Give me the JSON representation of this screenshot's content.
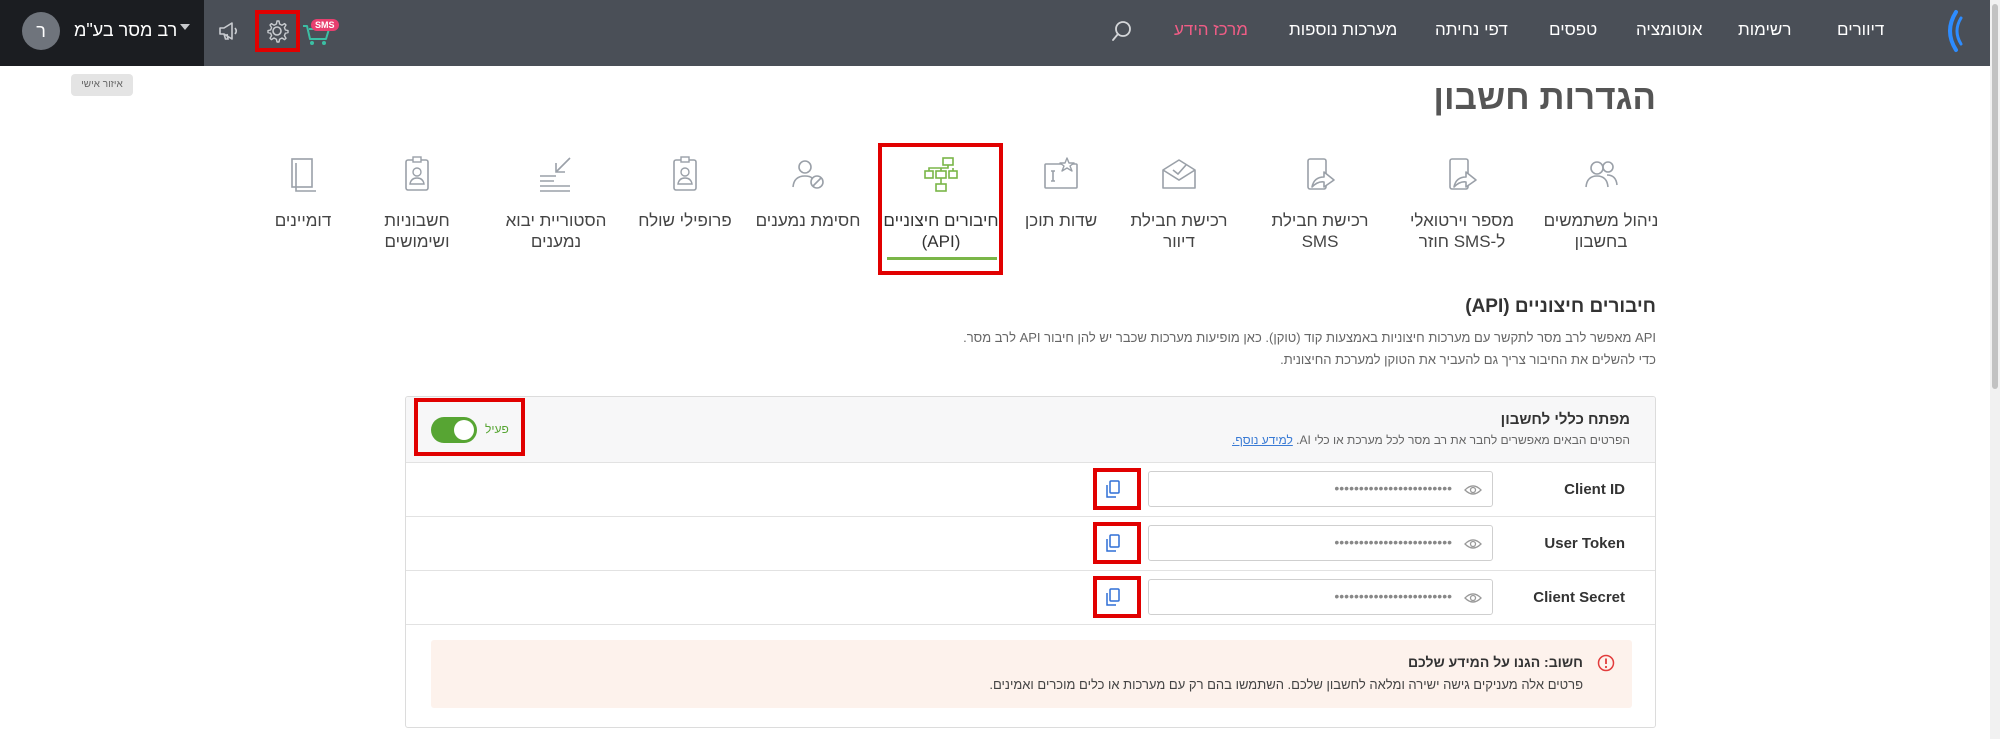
{
  "account": {
    "avatar_letter": "ר",
    "name": "רב מסר בע\"מ"
  },
  "topbar": {
    "sms_badge": "SMS",
    "nav": [
      "דיוורים",
      "רשימות",
      "אוטומציה",
      "טפסים",
      "דפי נחיתה",
      "מערכות נוספות",
      "מרכז הידע"
    ],
    "active_nav": "מרכז הידע",
    "icons": [
      "megaphone-icon",
      "gear-icon",
      "cart-icon",
      "search-icon",
      "logo-icon"
    ]
  },
  "tooltip": "איזור אישי",
  "page_title": "הגדרות חשבון",
  "tiles": [
    {
      "label_1": "ניהול משתמשים",
      "label_2": "בחשבון"
    },
    {
      "label_1": "מספר וירטואלי",
      "label_2": "ל-SMS חוזר"
    },
    {
      "label_1": "רכישת חבילת",
      "label_2": "SMS"
    },
    {
      "label_1": "רכישת חבילת",
      "label_2": "דיוור"
    },
    {
      "label_1": "שדות תוכן",
      "label_2": ""
    },
    {
      "label_1": "חיבורים חיצוניים",
      "label_2": "(API)"
    },
    {
      "label_1": "חסימת נמענים",
      "label_2": ""
    },
    {
      "label_1": "פרופילי שולח",
      "label_2": ""
    },
    {
      "label_1": "הסטוריית יבוא",
      "label_2": "נמענים"
    },
    {
      "label_1": "חשבוניות",
      "label_2": "ושימושים"
    },
    {
      "label_1": "דומיינים",
      "label_2": ""
    }
  ],
  "active_tile": "חיבורים חיצוניים (API)",
  "section": {
    "title": "חיבורים חיצוניים (API)",
    "desc_1": "API מאפשר לרב מסר לתקשר עם מערכות חיצוניות באמצעות קוד (טוקן). כאן מופיעות מערכות שכבר יש להן חיבור API לרב מסר.",
    "desc_2": "כדי להשלים את החיבור צריך גם להעביר את הטוקן למערכת החיצונית."
  },
  "card": {
    "title": "מפתח כללי לחשבון",
    "subtitle": "הפרטים הבאים מאפשרים לחבר את רב מסר לכל מערכת או כלי AI.",
    "more_link": "למידע נוסף.",
    "toggle_label": "פעיל",
    "toggle_on": true,
    "rows": [
      {
        "label": "Client ID",
        "value": "••••••••••••••••••••••••"
      },
      {
        "label": "User Token",
        "value": "••••••••••••••••••••••••"
      },
      {
        "label": "Client Secret",
        "value": "••••••••••••••••••••••••"
      }
    ],
    "warning_title": "חשוב: הגנו על המידע שלכם",
    "warning_text": "פרטים אלה מעניקים גישה ישירה ומלאה לחשבון שלכם. השתמשו בהם רק עם מערכות או כלים מוכרים ואמינים."
  },
  "colors": {
    "topbar": "#4a4f57",
    "account_box": "#1b1d21",
    "accent_pink": "#f05d86",
    "accent_green": "#57a533",
    "highlight_red": "#e10000",
    "link_blue": "#3a7bd5"
  }
}
